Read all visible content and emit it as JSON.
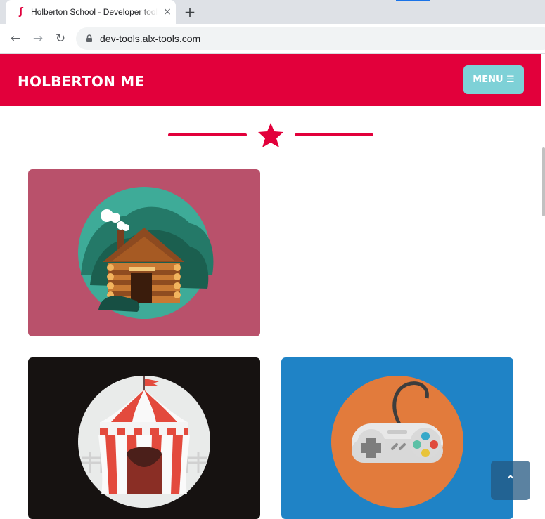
{
  "browser": {
    "tab_title": "Holberton School - Developer tools",
    "favicon": "holberton-seahorse-icon",
    "new_tab": "+",
    "close": "×",
    "url": "dev-tools.alx-tools.com"
  },
  "header": {
    "brand": "HOLBERTON ME",
    "menu_label": "MENU ☰",
    "brand_color": "#e2003b",
    "menu_color": "#7ed1d7"
  },
  "divider": {
    "icon": "star-icon"
  },
  "cards": [
    {
      "icon": "log-cabin-illustration",
      "background": "#b9516b"
    },
    {
      "icon": "circus-tent-illustration",
      "background": "#161211"
    },
    {
      "icon": "game-controller-illustration",
      "background": "#1f83c6"
    }
  ],
  "scroll_top": {
    "icon": "chevron-up-icon",
    "label": "⌃"
  }
}
